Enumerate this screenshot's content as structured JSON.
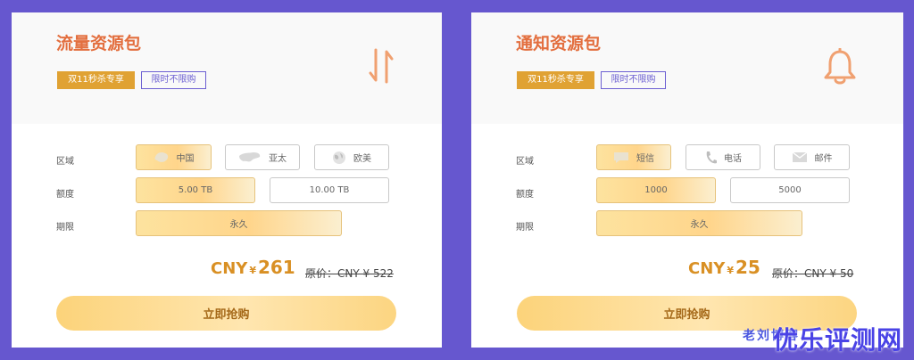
{
  "colors": {
    "accent": "#e36f3f",
    "gold": "#e0a233",
    "purple": "#6c5fd2",
    "price": "#d99024"
  },
  "card_traffic": {
    "title": "流量资源包",
    "tag_hot": "双11秒杀专享",
    "tag_limit": "限时不限购",
    "icon": "transfer-arrows-icon",
    "region_label": "区域",
    "regions": [
      "中国",
      "亚太",
      "欧美"
    ],
    "amount_label": "额度",
    "amounts": [
      "5.00 TB",
      "10.00 TB"
    ],
    "term_label": "期限",
    "term": "永久",
    "price_cur": "CNY",
    "price_yen": "¥",
    "price": "261",
    "orig_price": "原价：CNY ¥ 522",
    "buy": "立即抢购"
  },
  "card_notice": {
    "title": "通知资源包",
    "tag_hot": "双11秒杀专享",
    "tag_limit": "限时不限购",
    "icon": "bell-icon",
    "region_label": "区域",
    "channels": [
      "短信",
      "电话",
      "邮件"
    ],
    "amount_label": "额度",
    "amounts": [
      "1000",
      "5000"
    ],
    "term_label": "期限",
    "term": "永久",
    "price_cur": "CNY",
    "price_yen": "¥",
    "price": "25",
    "orig_price": "原价：CNY ¥ 50",
    "buy": "立即抢购"
  },
  "watermark": {
    "small": "老刘博客",
    "large": "优乐评测网"
  }
}
